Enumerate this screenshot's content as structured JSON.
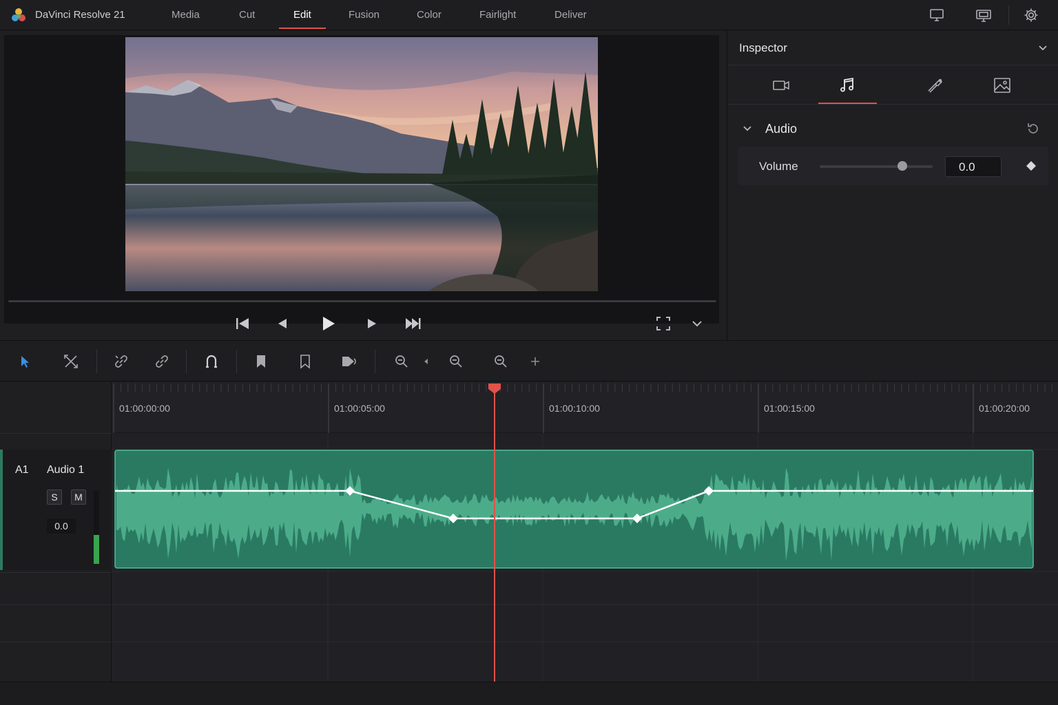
{
  "app": {
    "title": "DaVinci Resolve 21",
    "accent": "#e0524a"
  },
  "pages": {
    "items": [
      "Media",
      "Cut",
      "Edit",
      "Fusion",
      "Color",
      "Fairlight",
      "Deliver"
    ],
    "active": "Edit"
  },
  "top_icons": [
    "single-monitor-icon",
    "dual-monitor-icon",
    "settings-gear-icon"
  ],
  "viewer": {
    "transport": [
      "go-to-start-icon",
      "step-back-icon",
      "play-icon",
      "step-forward-icon",
      "go-to-end-icon"
    ],
    "fullscreen_icon": "fullscreen-icon",
    "options_icon": "chevron-down-icon"
  },
  "inspector": {
    "title": "Inspector",
    "tabs": [
      "video-tab-icon",
      "audio-tab-icon",
      "effects-tab-icon",
      "image-tab-icon"
    ],
    "active_tab": "audio-tab-icon",
    "section": {
      "title": "Audio",
      "volume": {
        "label": "Volume",
        "value": "0.0",
        "slider_level": 0.72
      }
    }
  },
  "toolbar": {
    "tools": [
      "selection-tool-icon",
      "trim-tool-icon",
      "link-icon",
      "unlink-icon",
      "snapping-icon",
      "flag-icon",
      "marker-icon",
      "audio-level-icon",
      "zoom-out-icon",
      "zoom-in-icon",
      "zoom-fit-icon",
      "add-icon"
    ]
  },
  "timeline": {
    "timecodes": [
      "01:00:00:00",
      "01:00:05:00",
      "01:00:10:00",
      "01:00:15:00",
      "01:00:20:00"
    ],
    "track": {
      "id": "A1",
      "name": "Audio 1",
      "solo": "S",
      "mute": "M",
      "volume": "0.0",
      "meter_level": 0.4,
      "clip_color": "#2a7a62"
    }
  }
}
